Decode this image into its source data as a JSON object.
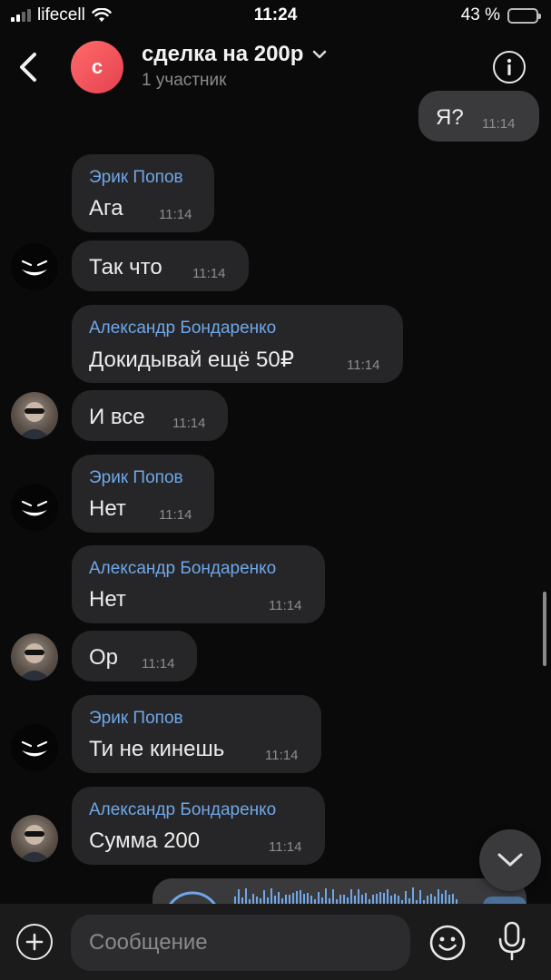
{
  "status_bar": {
    "carrier": "lifecell",
    "time": "11:24",
    "battery": "43 %",
    "battery_level": 0.43
  },
  "header": {
    "avatar_letter": "с",
    "title": "сделка на 200р",
    "subtitle": "1 участник"
  },
  "messages": [
    {
      "id": "m0",
      "text": "Я?",
      "time": "11:14",
      "outgoing": true
    },
    {
      "id": "m1",
      "sender": "Эрик Попов",
      "text": "Ага",
      "time": "11:14"
    },
    {
      "id": "m2",
      "text": "Так что",
      "time": "11:14"
    },
    {
      "id": "m3",
      "sender": "Александр Бондаренко",
      "text": "Докидывай ещё 50₽",
      "time": "11:14"
    },
    {
      "id": "m4",
      "text": "И все",
      "time": "11:14"
    },
    {
      "id": "m5",
      "sender": "Эрик Попов",
      "text": "Нет",
      "time": "11:14"
    },
    {
      "id": "m6",
      "sender": "Александр Бондаренко",
      "text": "Нет",
      "time": "11:14"
    },
    {
      "id": "m7",
      "text": "Ор",
      "time": "11:14"
    },
    {
      "id": "m8",
      "sender": "Эрик Попов",
      "text": "Ти не кинешь",
      "time": "11:14"
    },
    {
      "id": "m9",
      "sender": "Александр Бондаренко",
      "text": "Сумма 200",
      "time": "11:14"
    }
  ],
  "composer": {
    "placeholder": "Сообщение"
  },
  "colors": {
    "accent_name": "#6fa7e8",
    "bubble": "#262628",
    "outgoing_bubble": "#3a3a3c",
    "battery": "#f6c33b"
  },
  "icons": [
    "back-arrow-icon",
    "info-icon",
    "chevron-down-icon",
    "plus-icon",
    "emoji-icon",
    "microphone-icon",
    "wifi-icon",
    "signal-icon",
    "battery-icon"
  ]
}
